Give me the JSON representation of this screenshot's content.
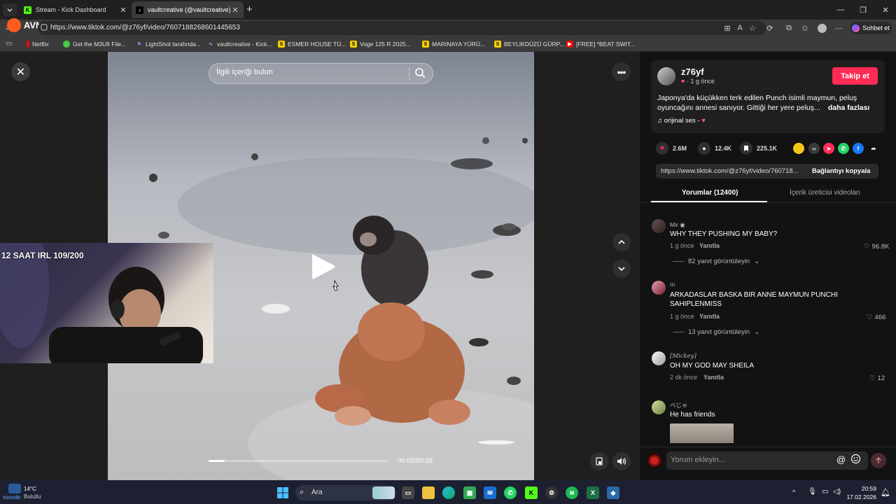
{
  "browser": {
    "tabs": [
      {
        "label": "Stream - Kick Dashboard",
        "active": false
      },
      {
        "label": "vaultcreative (@vaultcreative) | Tik",
        "active": true
      }
    ],
    "url": "https://www.tiktok.com/@z76yf/video/7607188268601445653",
    "overlay_brand": "AVM",
    "chat_label": "Sohbet et",
    "bookmarks": [
      "Netflix",
      "Get the M3U8 File...",
      "LightShot tarafında...",
      "vaultcreative - Kick...",
      "ESMER HOUSE TÜ...",
      "Voge 125 R 2025...",
      "MARINAYA YÜRÜ...",
      "BEYLİKDÜZÜ GÜRP...",
      "[FREE] *BEAT SWIT..."
    ]
  },
  "video": {
    "search_placeholder": "İlgili içeriği bulun",
    "time": "00:02/00:26",
    "progress_fraction": 0.09,
    "stream_overlay": "12 SAAT IRL 109/200"
  },
  "post": {
    "author": "z76yf",
    "author_sub": "· 1 g önce",
    "follow_label": "Takip et",
    "description": "Japonya'da küçükken terk edilen Punch isimli maymun, peluş oyuncağını annesi sanıyor. Gittiği her yere peluş...",
    "more_label": "daha fazlası",
    "sound": "orijinal ses -",
    "likes": "2.6M",
    "comments": "12.4K",
    "saves": "225.1K",
    "share_link": "https://www.tiktok.com/@z76yf/video/760718...",
    "copy_label": "Bağlantıyı kopyala",
    "tab_comments": "Yorumlar (12400)",
    "tab_creator": "İçerik üreticisi videoları"
  },
  "comments": [
    {
      "name": "Mir",
      "text": "WHY THEY PUSHING MY BABY?",
      "time": "1 g önce",
      "reply": "Yanıtla",
      "likes": "96.8K",
      "replies": "82 yanıt görüntüleyin"
    },
    {
      "name": "ꙆꙆꙆ",
      "text": "ARKADASLAR BASKA BIR ANNE MAYMUN PUNCHI SAHIPLENMISS",
      "time": "1 g önce",
      "reply": "Yanıtla",
      "likes": "466",
      "replies": "13 yanıt görüntüleyin"
    },
    {
      "name": "[Mickey]",
      "text": "OH MY GOD MAY SHEILA",
      "time": "2 dk önce",
      "reply": "Yanıtla",
      "likes": "12",
      "replies": ""
    },
    {
      "name": "ベじゃ",
      "text": "He has friends",
      "time": "",
      "reply": "",
      "likes": "",
      "replies": ""
    }
  ],
  "comment_input_placeholder": "Yorum ekleyin...",
  "taskbar": {
    "temp": "14°C",
    "weather": "Bulutlu",
    "user_label": "xoxsde",
    "search": "Ara",
    "time": "20:59",
    "date": "17.02.2026"
  },
  "colors": {
    "accent": "#fe2c55",
    "like": "#fe2c55"
  }
}
